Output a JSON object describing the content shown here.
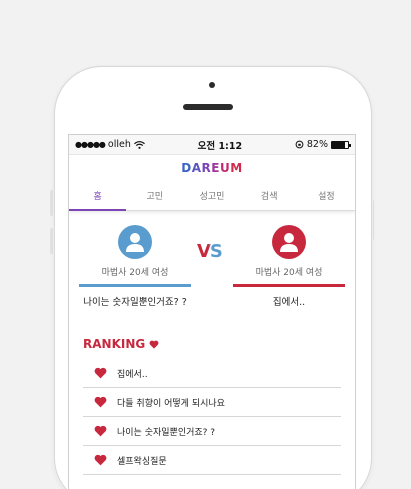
{
  "colors": {
    "accent": "#7b45b6",
    "blue": "#5a9ccd",
    "red": "#c8283d"
  },
  "statusbar": {
    "carrier": "olleh",
    "time": "오전 1:12",
    "battery": "82%",
    "battery_level": 0.82
  },
  "app": {
    "logo_letters": [
      {
        "char": "D",
        "color": "#3b63c5"
      },
      {
        "char": "A",
        "color": "#5a55c0"
      },
      {
        "char": "R",
        "color": "#7a45b6"
      },
      {
        "char": "E",
        "color": "#a0359a"
      },
      {
        "char": "U",
        "color": "#c32a6f"
      },
      {
        "char": "M",
        "color": "#d02a4d"
      }
    ]
  },
  "tabs": [
    "홈",
    "고민",
    "성고민",
    "검색",
    "설정"
  ],
  "vs": {
    "label": "VS",
    "left": {
      "gender": "마법사 20세 여성",
      "question": "나이는 숫자일뿐인거죠? ?"
    },
    "right": {
      "gender": "마법사 20세 여성",
      "question": "집에서.."
    }
  },
  "ranking": {
    "title": "RANKING",
    "items": [
      "집에서..",
      "다들 취향이 어떻게 되시나요",
      "나이는 숫자일뿐인거죠? ?",
      "셀프왁싱질문"
    ]
  }
}
